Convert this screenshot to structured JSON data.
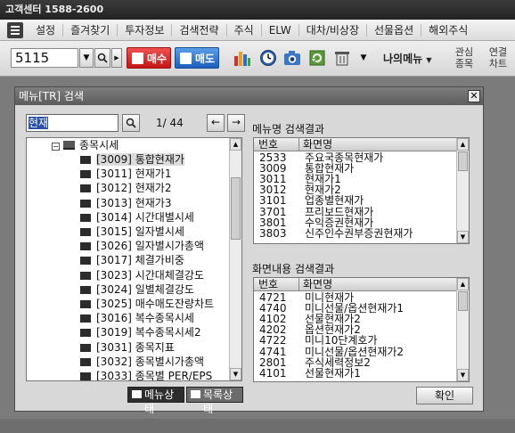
{
  "app": {
    "call_center": "고객센터 1588-2600"
  },
  "menubar": {
    "items": [
      "설정",
      "즐겨찾기",
      "투자정보",
      "검색전략",
      "주식",
      "ELW",
      "대차/비상장",
      "선물옵션",
      "해외주식"
    ]
  },
  "toolbar": {
    "stock_code": "5115",
    "buy_label": "매수",
    "sell_label": "매도",
    "my_menu_label": "나의메뉴",
    "interest_label_1": "관심",
    "interest_label_2": "종목",
    "link_label_1": "연결",
    "link_label_2": "차트"
  },
  "dialog": {
    "title": "메뉴[TR] 검색",
    "close_glyph": "✕",
    "search_value": "현재",
    "counter": "1/ 44",
    "prev_glyph": "←",
    "next_glyph": "→",
    "tree_root": "종목시세",
    "tree_items": [
      "[3009] 통합현재가",
      "[3011] 현재가1",
      "[3012] 현재가2",
      "[3013] 현재가3",
      "[3014] 시간대별시세",
      "[3015] 일자별시세",
      "[3026] 일자별시가총액",
      "[3017] 체결가비중",
      "[3023] 시간대체결강도",
      "[3024] 일별체결강도",
      "[3025] 매수매도잔량차트",
      "[3016] 복수종목시세",
      "[3019] 복수종목시세2",
      "[3031] 종목지표",
      "[3032] 종목별시가총액",
      "[3033] 종목별 PER/EPS"
    ],
    "tab_menu_state": "메뉴상태",
    "tab_list_state": "목록상태",
    "menu_result_label": "메뉴명 검색결과",
    "content_result_label": "화면내용 검색결과",
    "col_code": "번호",
    "col_name": "화면명",
    "menu_results": [
      {
        "code": "2533",
        "name": "주요국종목현재가"
      },
      {
        "code": "3009",
        "name": "통합현재가"
      },
      {
        "code": "3011",
        "name": "현재가1"
      },
      {
        "code": "3012",
        "name": "현재가2"
      },
      {
        "code": "3101",
        "name": "업종별현재가"
      },
      {
        "code": "3701",
        "name": "프리보드현재가"
      },
      {
        "code": "3801",
        "name": "수익증권현재가"
      },
      {
        "code": "3803",
        "name": "신주인수권부증권현재가"
      }
    ],
    "content_results": [
      {
        "code": "4721",
        "name": "미니현재가"
      },
      {
        "code": "4740",
        "name": "미니선물/옵션현재가1"
      },
      {
        "code": "4102",
        "name": "선물현재가2"
      },
      {
        "code": "4202",
        "name": "옵션현재가2"
      },
      {
        "code": "4722",
        "name": "미니10단계호가"
      },
      {
        "code": "4741",
        "name": "미니선물/옵션현재가2"
      },
      {
        "code": "2801",
        "name": "주식세력정보2"
      },
      {
        "code": "4101",
        "name": "선물현재가1"
      }
    ],
    "ok_label": "확인"
  }
}
